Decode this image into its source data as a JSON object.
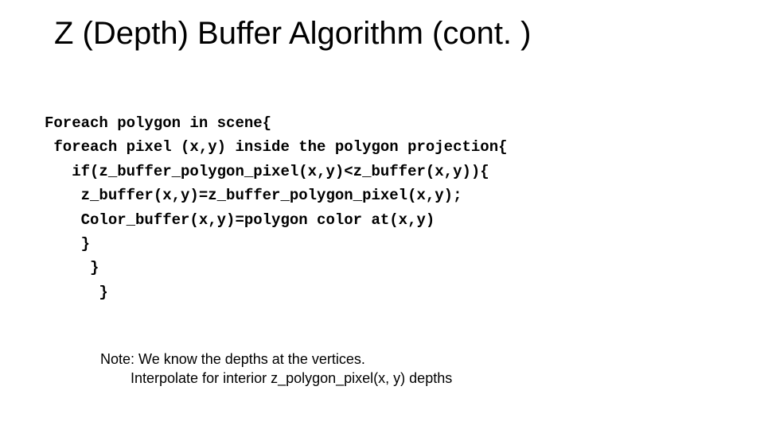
{
  "title": "Z (Depth) Buffer Algorithm (cont. )",
  "code": {
    "l1": "Foreach polygon in scene{",
    "l2": " foreach pixel (x,y) inside the polygon projection{",
    "l3": "   if(z_buffer_polygon_pixel(x,y)<z_buffer(x,y)){",
    "l4": "    z_buffer(x,y)=z_buffer_polygon_pixel(x,y);",
    "l5": "    Color_buffer(x,y)=polygon color at(x,y)",
    "l6": "    }",
    "l7": "     }",
    "l8": "      }"
  },
  "note": {
    "line1": "Note: We know the depths at the vertices.",
    "line2": "Interpolate for interior z_polygon_pixel(x, y) depths"
  }
}
